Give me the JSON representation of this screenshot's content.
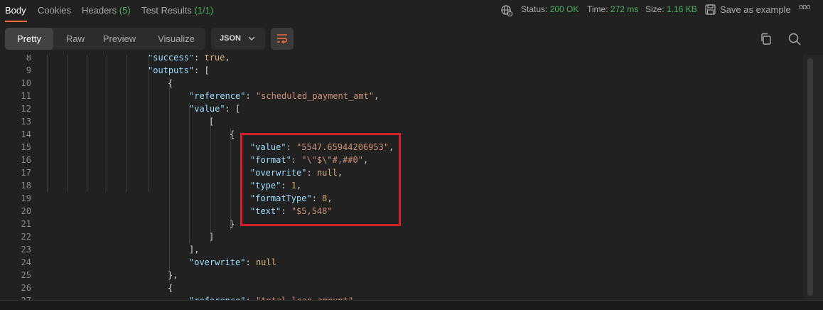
{
  "tabs": [
    {
      "label": "Body",
      "active": true
    },
    {
      "label": "Cookies"
    },
    {
      "label": "Headers",
      "count": "(5)"
    },
    {
      "label": "Test Results",
      "count": "(1/1)"
    }
  ],
  "status": {
    "status_label": "Status:",
    "status_value": "200 OK",
    "time_label": "Time:",
    "time_value": "272 ms",
    "size_label": "Size:",
    "size_value": "1.16 KB",
    "save_label": "Save as example",
    "more": "ooo"
  },
  "view_modes": [
    {
      "label": "Pretty",
      "active": true
    },
    {
      "label": "Raw"
    },
    {
      "label": "Preview"
    },
    {
      "label": "Visualize"
    }
  ],
  "format_select": {
    "value": "JSON"
  },
  "colors": {
    "accent": "#ff6c37",
    "status_green": "#46b05d",
    "highlight_red": "#d1202a",
    "key_blue": "#9cdcfe",
    "string_orange": "#ce9178"
  },
  "icons": {
    "network": "globe-icon",
    "save": "save-icon",
    "wrap": "wrap-lines-icon",
    "copy": "copy-icon",
    "search": "search-icon",
    "dropdown": "chevron-down-icon"
  },
  "code": {
    "lines": [
      {
        "n": "8",
        "parts": [
          [
            "k",
            "\"success\""
          ],
          [
            "p",
            ": "
          ],
          [
            "lit",
            "true"
          ],
          [
            "p",
            ","
          ]
        ]
      },
      {
        "n": "9",
        "parts": [
          [
            "k",
            "\"outputs\""
          ],
          [
            "p",
            ": ["
          ]
        ]
      },
      {
        "n": "10",
        "parts": [
          [
            "p",
            "{"
          ]
        ]
      },
      {
        "n": "11",
        "parts": [
          [
            "k",
            "\"reference\""
          ],
          [
            "p",
            ": "
          ],
          [
            "s",
            "\"scheduled_payment_amt\""
          ],
          [
            "p",
            ","
          ]
        ]
      },
      {
        "n": "12",
        "parts": [
          [
            "k",
            "\"value\""
          ],
          [
            "p",
            ": ["
          ]
        ]
      },
      {
        "n": "13",
        "parts": [
          [
            "p",
            "["
          ]
        ]
      },
      {
        "n": "14",
        "parts": [
          [
            "p",
            "{"
          ]
        ]
      },
      {
        "n": "15",
        "parts": [
          [
            "k",
            "\"value\""
          ],
          [
            "p",
            ": "
          ],
          [
            "s",
            "\"5547.65944206953\""
          ],
          [
            "p",
            ","
          ]
        ]
      },
      {
        "n": "16",
        "parts": [
          [
            "k",
            "\"format\""
          ],
          [
            "p",
            ": "
          ],
          [
            "s",
            "\"\\\"$\\\"#,##0\""
          ],
          [
            "p",
            ","
          ]
        ]
      },
      {
        "n": "17",
        "parts": [
          [
            "k",
            "\"overwrite\""
          ],
          [
            "p",
            ": "
          ],
          [
            "lit",
            "null"
          ],
          [
            "p",
            ","
          ]
        ]
      },
      {
        "n": "18",
        "parts": [
          [
            "k",
            "\"type\""
          ],
          [
            "p",
            ": "
          ],
          [
            "num",
            "1"
          ],
          [
            "p",
            ","
          ]
        ]
      },
      {
        "n": "19",
        "parts": [
          [
            "k",
            "\"formatType\""
          ],
          [
            "p",
            ": "
          ],
          [
            "num",
            "8"
          ],
          [
            "p",
            ","
          ]
        ]
      },
      {
        "n": "20",
        "parts": [
          [
            "k",
            "\"text\""
          ],
          [
            "p",
            ": "
          ],
          [
            "s",
            "\"$5,548\""
          ]
        ]
      },
      {
        "n": "21",
        "parts": [
          [
            "p",
            "}"
          ]
        ]
      },
      {
        "n": "22",
        "parts": [
          [
            "p",
            "]"
          ]
        ]
      },
      {
        "n": "23",
        "parts": [
          [
            "p",
            "],"
          ]
        ]
      },
      {
        "n": "24",
        "parts": [
          [
            "k",
            "\"overwrite\""
          ],
          [
            "p",
            ": "
          ],
          [
            "lit",
            "null"
          ]
        ]
      },
      {
        "n": "25",
        "parts": [
          [
            "p",
            "},"
          ]
        ]
      },
      {
        "n": "26",
        "parts": [
          [
            "p",
            "{"
          ]
        ]
      },
      {
        "n": "27",
        "parts": [
          [
            "k",
            "\"reference\""
          ],
          [
            "p",
            ": "
          ],
          [
            "s",
            "\"total_loan_amount\""
          ],
          [
            "p",
            ","
          ]
        ]
      }
    ]
  }
}
